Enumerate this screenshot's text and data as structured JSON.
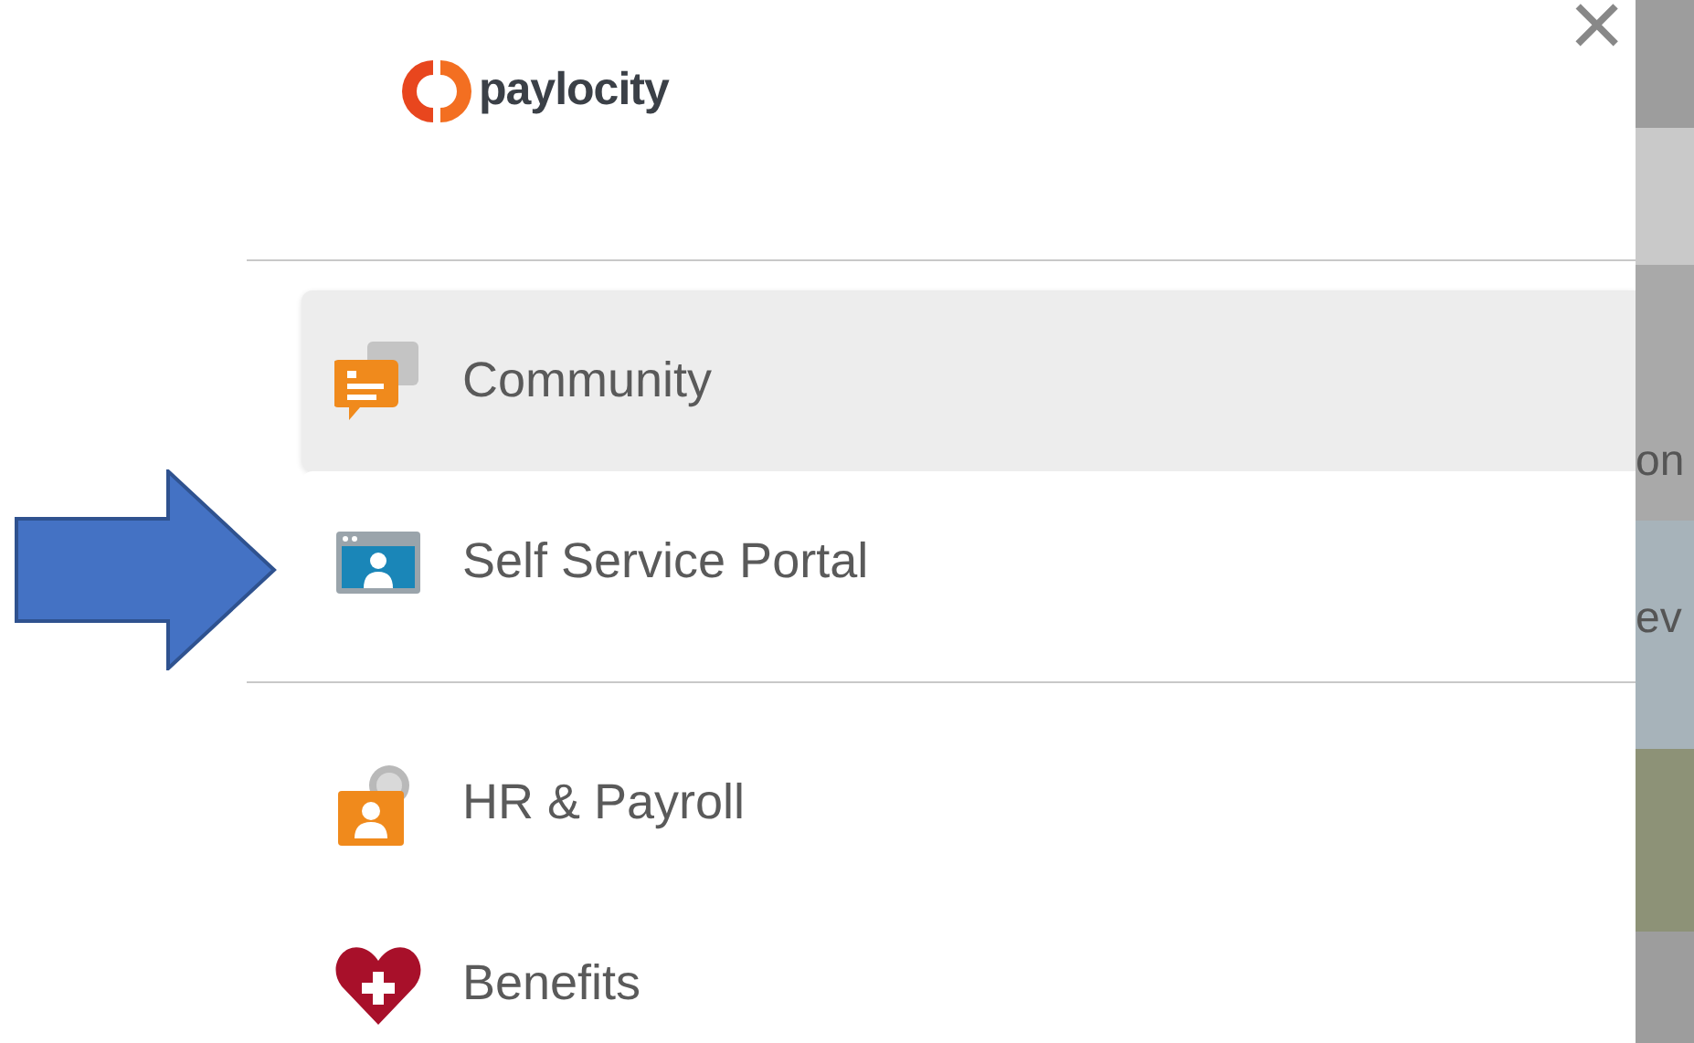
{
  "logo": {
    "text": "paylocity"
  },
  "close": {
    "label": "×"
  },
  "sections": [
    {
      "items": [
        {
          "label": "Community",
          "kind": "community",
          "selected": true
        },
        {
          "label": "Self Service Portal",
          "kind": "portal",
          "selected": false
        }
      ]
    },
    {
      "items": [
        {
          "label": "HR & Payroll",
          "kind": "hr",
          "selected": false
        },
        {
          "label": "Benefits",
          "kind": "benefits",
          "selected": false
        }
      ]
    }
  ],
  "background_page": {
    "fragments": [
      "on",
      "ev"
    ]
  }
}
